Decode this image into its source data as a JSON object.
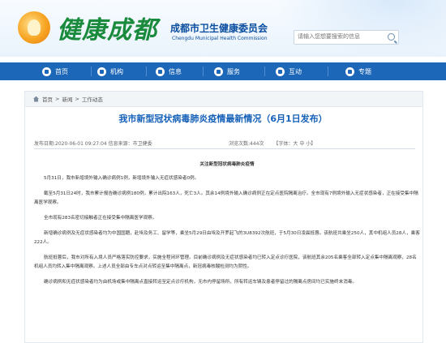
{
  "header": {
    "brand": "健康成都",
    "org_cn": "成都市卫生健康委员会",
    "org_en": "Chengdu Municipal Health Commission",
    "search_placeholder": "请输入您想要搜索的信息"
  },
  "nav": {
    "items": [
      {
        "label": "首页",
        "icon": "home-icon"
      },
      {
        "label": "机构",
        "icon": "building-icon"
      },
      {
        "label": "信息",
        "icon": "info-icon"
      },
      {
        "label": "服务",
        "icon": "service-icon"
      },
      {
        "label": "互动",
        "icon": "chat-icon"
      },
      {
        "label": "专题",
        "icon": "topic-icon"
      }
    ]
  },
  "breadcrumb": [
    "首页",
    "新闻",
    "工作动态"
  ],
  "breadcrumb_sep": ">",
  "article": {
    "title": "我市新型冠状病毒肺炎疫情最新情况（6月1日发布）",
    "published": "发布日期:2020-06-01 09:27:04",
    "source": "信息来源：市卫健委",
    "views_label": "浏览次数:444次",
    "font_size_label": "【字体：大 中 小】",
    "subheading": "关注新型冠状病毒肺炎疫情",
    "paragraphs": [
      "5月31日，我市新增境外输入确诊病例1例，新增境外输入无症状感染者0例。",
      "截至5月31日24时，我市累计报告确诊病例180例，累计出院163人，死亡3人。其余14例境外输入确诊病例正在定点医院隔离治疗。全市现有7例境外输入无症状感染者，正在接受集中隔离医学观察。",
      "全市现有283名密切接触者正在接受集中隔离医学观察。",
      "新增确诊病例及无症状感染者均为中国国籍，赴埃及务工、留学等，乘坐5月29日由埃及开罗起飞的3U8392次航班，于5月30日凌晨抵蓉。该航班共乘坐250人，其中机组人员28人，乘客222人。",
      "航班抵蓉后，我市对所有入境人员严格落实防控要求，实施全程闭环管理。目前确诊病例及无症状感染者均已转入定点诊疗医院，该航班其余205名乘客全部转入定点集中隔离观察，28名机组人员均转入集中隔离观察。上述人员全部由专车点对点转运至集中隔离点，新冠病毒核酸检测均为阴性。",
      "确诊病例和无症状感染者均为由机场或集中隔离点直接转运至定点诊疗机构，无市内停留场所，所有转运车辆及患者停留过的隔离点房间均已实施终末消毒。"
    ]
  },
  "colors": {
    "nav_bg": "#1d67b8",
    "title": "#1560b8",
    "brand": "#1a8a3c",
    "org": "#0b4fa0"
  }
}
